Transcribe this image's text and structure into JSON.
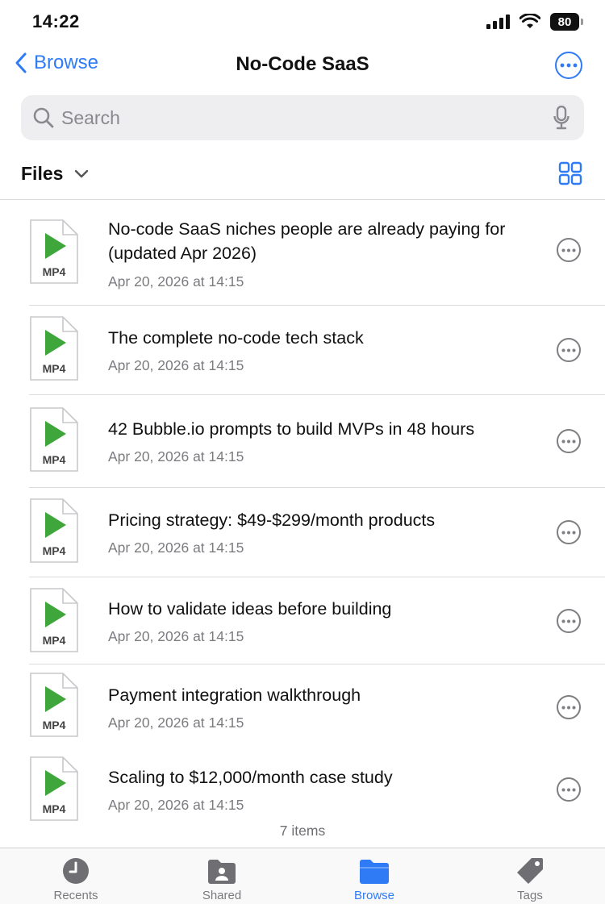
{
  "status_bar": {
    "time": "14:22",
    "battery": "80"
  },
  "nav": {
    "back_label": "Browse",
    "title": "No-Code SaaS"
  },
  "search": {
    "placeholder": "Search",
    "value": ""
  },
  "files_header": {
    "label": "Files"
  },
  "files": [
    {
      "title": "No-code SaaS niches people are already paying for (updated Apr 2026)",
      "date": "Apr 20, 2026 at 14:15",
      "ext": "MP4"
    },
    {
      "title": "The complete no-code tech stack",
      "date": "Apr 20, 2026 at 14:15",
      "ext": "MP4"
    },
    {
      "title": "42 Bubble.io prompts to build MVPs in 48 hours",
      "date": "Apr 20, 2026 at 14:15",
      "ext": "MP4"
    },
    {
      "title": "Pricing strategy: $49-$299/month products",
      "date": "Apr 20, 2026 at 14:15",
      "ext": "MP4"
    },
    {
      "title": "How to validate ideas before building",
      "date": "Apr 20, 2026 at 14:15",
      "ext": "MP4"
    },
    {
      "title": "Payment integration walkthrough",
      "date": "Apr 20, 2026 at 14:15",
      "ext": "MP4"
    },
    {
      "title": "Scaling to $12,000/month case study",
      "date": "Apr 20, 2026 at 14:15",
      "ext": "MP4"
    }
  ],
  "item_count": "7 items",
  "tabs": [
    {
      "label": "Recents",
      "icon": "clock-icon",
      "active": false
    },
    {
      "label": "Shared",
      "icon": "shared-folder-icon",
      "active": false
    },
    {
      "label": "Browse",
      "icon": "folder-icon",
      "active": true
    },
    {
      "label": "Tags",
      "icon": "tag-icon",
      "active": false
    }
  ],
  "colors": {
    "accent": "#2f7bf6",
    "play": "#3fa63b",
    "secondary_text": "#7c7c80"
  }
}
